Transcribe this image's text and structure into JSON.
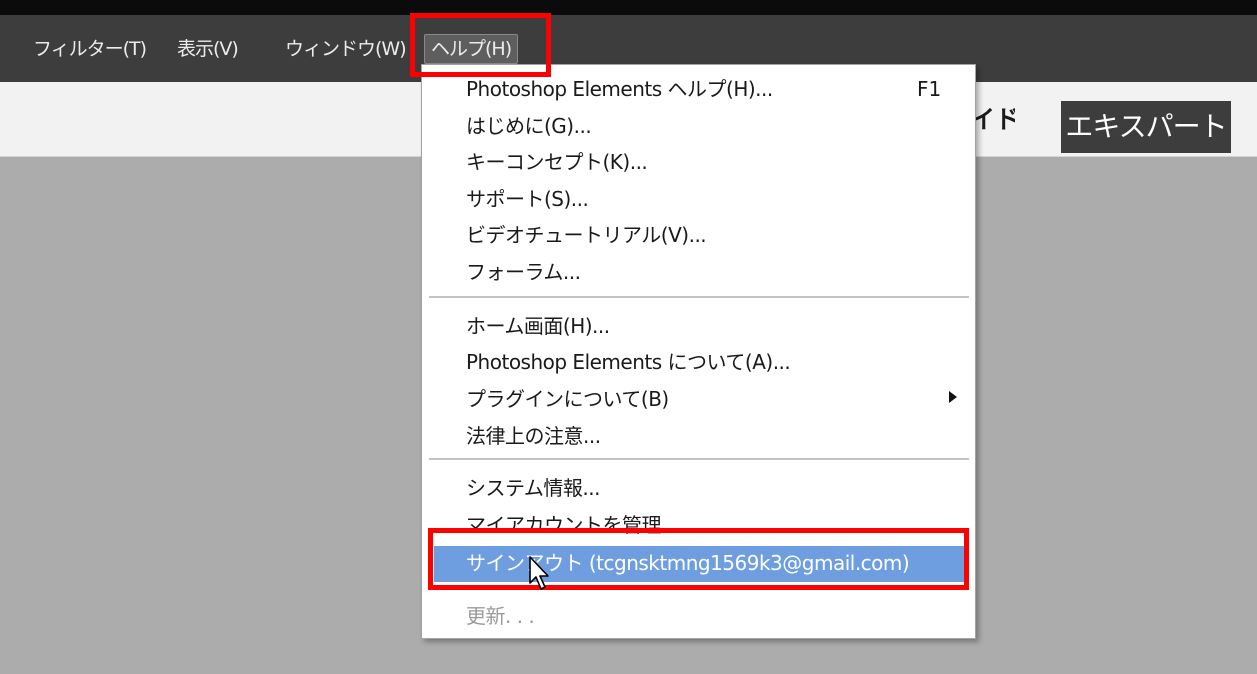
{
  "menubar": {
    "items": [
      {
        "label": "フィルター(T)"
      },
      {
        "label": "表示(V)"
      },
      {
        "label": "ウィンドウ(W)"
      },
      {
        "label": "ヘルプ(H)"
      }
    ]
  },
  "toolbar": {
    "partial_mode_label": "イド",
    "expert_tab": "エキスパート"
  },
  "help_menu": {
    "items": [
      {
        "label": "Photoshop Elements ヘルプ(H)...",
        "shortcut": "F1"
      },
      {
        "label": "はじめに(G)..."
      },
      {
        "label": "キーコンセプト(K)..."
      },
      {
        "label": "サポート(S)..."
      },
      {
        "label": "ビデオチュートリアル(V)..."
      },
      {
        "label": "フォーラム..."
      },
      {
        "label": "ホーム画面(H)..."
      },
      {
        "label": "Photoshop Elements について(A)..."
      },
      {
        "label": "プラグインについて(B)"
      },
      {
        "label": "法律上の注意..."
      },
      {
        "label": "システム情報..."
      },
      {
        "label": "マイアカウントを管理..."
      },
      {
        "label": "サインアウト (tcgnsktmng1569k3@gmail.com)"
      },
      {
        "label": "更新. . ."
      }
    ]
  },
  "colors": {
    "menubar_bg": "#3d3d3d",
    "highlight": "#6f9ee0",
    "annotation_red": "#ff0000",
    "workspace_bg": "#acacac"
  },
  "icons": {
    "cursor": "mouse-pointer-icon",
    "submenu": "submenu-arrow-icon"
  }
}
